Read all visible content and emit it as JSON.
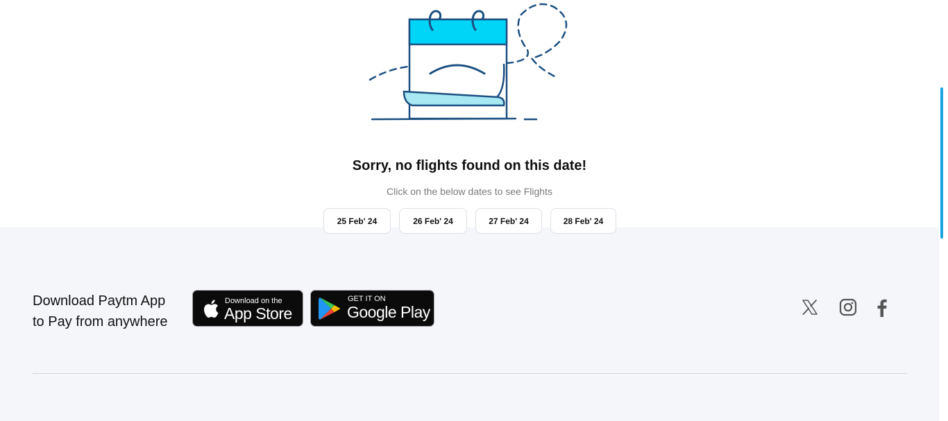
{
  "empty_state": {
    "title": "Sorry, no flights found on this date!",
    "subtitle": "Click on the below dates to see Flights",
    "illustration_icon": "sad-calendar-icon"
  },
  "dates": [
    {
      "label": "25 Feb' 24"
    },
    {
      "label": "26 Feb' 24"
    },
    {
      "label": "27 Feb' 24"
    },
    {
      "label": "28 Feb' 24"
    }
  ],
  "footer": {
    "download_line1": "Download Paytm App",
    "download_line2": "to Pay from anywhere",
    "app_store": {
      "small": "Download on the",
      "big": "App Store",
      "icon": "apple-icon"
    },
    "google_play": {
      "small": "GET IT ON",
      "big": "Google Play",
      "icon": "play-store-icon"
    },
    "social": [
      "x-icon",
      "instagram-icon",
      "facebook-icon"
    ]
  },
  "colors": {
    "accent_cyan": "#00d5f8",
    "illustration_stroke": "#1b4f80",
    "footer_bg": "#f5f6fa",
    "scroll_thumb": "#1ba4e4"
  }
}
